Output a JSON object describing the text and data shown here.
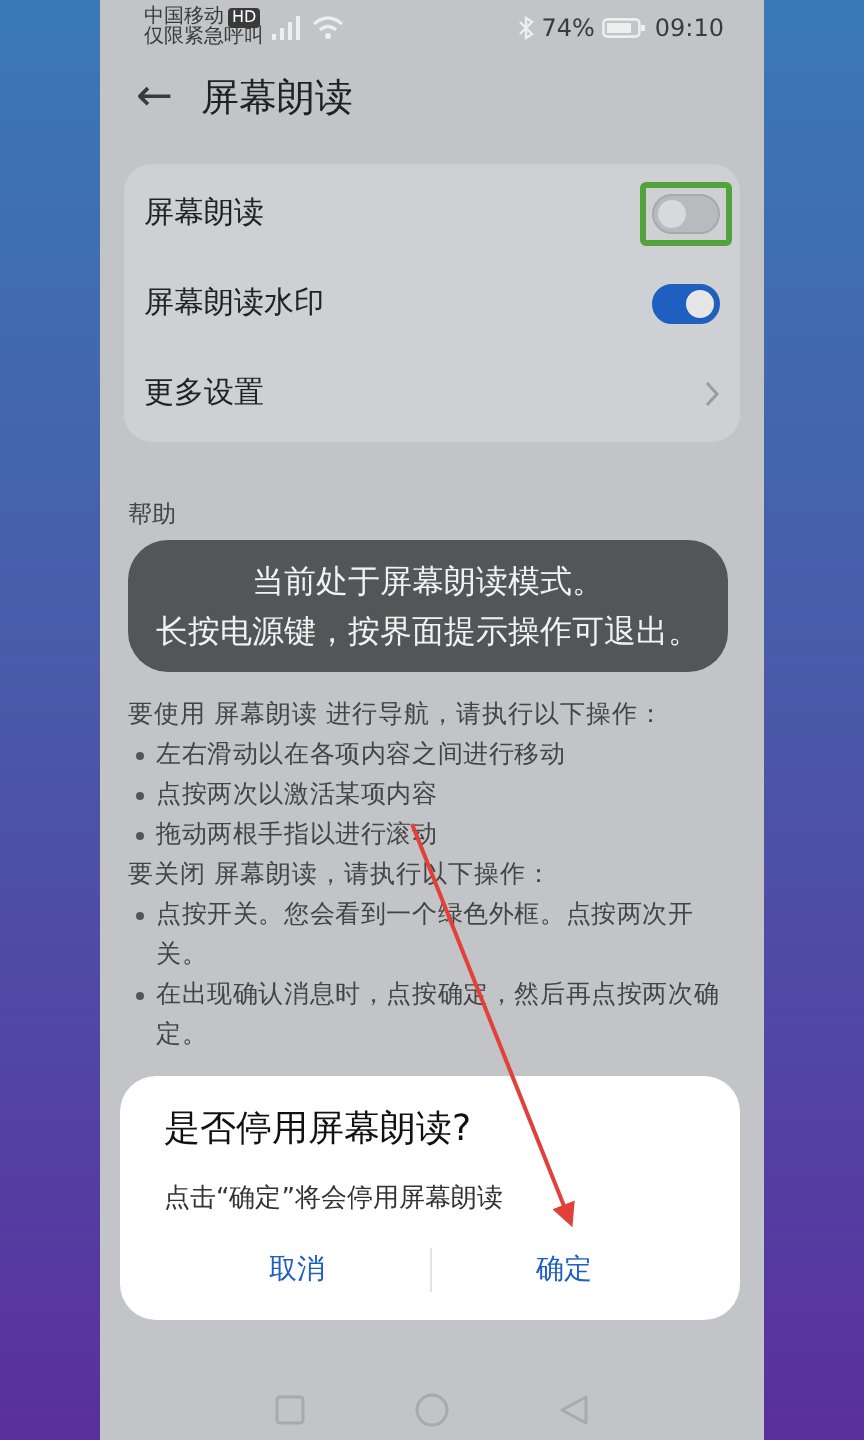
{
  "status_bar": {
    "carrier": "中国移动",
    "carrier_badge": "HD",
    "carrier_note": "仅限紧急呼叫",
    "battery": "74%",
    "time": "09:10"
  },
  "header": {
    "back": "←",
    "title": "屏幕朗读"
  },
  "settings": [
    {
      "kind": "toggle",
      "label": "屏幕朗读",
      "on": false,
      "focused": true
    },
    {
      "kind": "toggle",
      "label": "屏幕朗读水印",
      "on": true,
      "focused": false
    },
    {
      "kind": "link",
      "label": "更多设置"
    }
  ],
  "help": {
    "title": "帮助",
    "items": [
      {
        "kind": "text",
        "text": "要使用 屏幕朗读 进行导航，请执行以下操作："
      },
      {
        "kind": "bullet",
        "text": "左右滑动以在各项内容之间进行移动"
      },
      {
        "kind": "bullet",
        "text": "点按两次以激活某项内容"
      },
      {
        "kind": "bullet",
        "text": "拖动两根手指以进行滚动"
      },
      {
        "kind": "text",
        "text": "要关闭 屏幕朗读，请执行以下操作："
      },
      {
        "kind": "bullet",
        "text": "点按开关。您会看到一个绿色外框。点按两次开关。"
      },
      {
        "kind": "bullet",
        "text": "在出现确认消息时，点按确定，然后再点按两次确定。"
      }
    ]
  },
  "toast": {
    "lines": [
      "当前处于屏幕朗读模式。",
      "长按电源键，按界面提示操作可退出。"
    ]
  },
  "dialog": {
    "title": "是否停用屏幕朗读?",
    "message": "点击“确定”将会停用屏幕朗读",
    "buttons": [
      "取消",
      "确定"
    ]
  }
}
